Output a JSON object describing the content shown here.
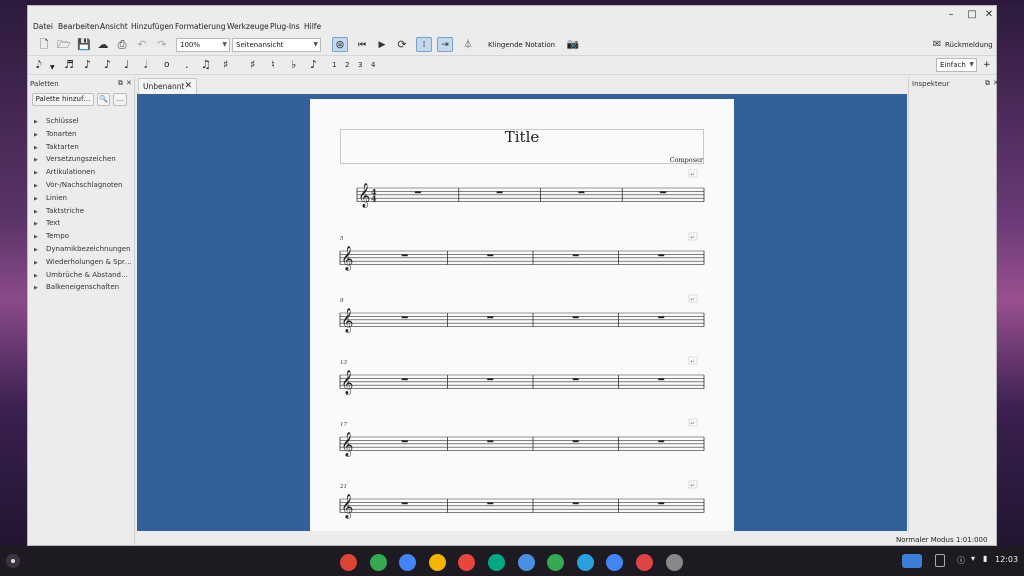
{
  "menu": [
    "Datei",
    "Bearbeiten",
    "Ansicht",
    "Hinzufügen",
    "Formatierung",
    "Werkzeuge",
    "Plug-Ins",
    "Hilfe"
  ],
  "toolbar": {
    "zoom": "100%",
    "view_mode": "Seitenansicht",
    "concert_pitch": "Klingende Notation",
    "feedback": "Rückmeldung"
  },
  "note_toolbar": {
    "voices": [
      "1",
      "2",
      "3",
      "4"
    ],
    "layout_mode": "Einfach",
    "add": "+"
  },
  "palettes": {
    "title": "Paletten",
    "add_button": "Palette hinzuf…",
    "items": [
      "Schlüssel",
      "Tonarten",
      "Taktarten",
      "Versetzungszeichen",
      "Artikulationen",
      "Vor-/Nachschlagnoten",
      "Linien",
      "Taktstriche",
      "Text",
      "Tempo",
      "Dynamikbezeichnungen",
      "Wiederholungen & Spr…",
      "Umbrüche & Abstand…",
      "Balkeneigenschaften"
    ]
  },
  "inspector": {
    "title": "Inspekteur"
  },
  "score_tab": {
    "label": "Unbenannt"
  },
  "score": {
    "title": "Title",
    "composer": "Composer",
    "time_signature": [
      "4",
      "4"
    ],
    "systems": [
      {
        "number": ""
      },
      {
        "number": "5"
      },
      {
        "number": "9"
      },
      {
        "number": "13"
      },
      {
        "number": "17"
      },
      {
        "number": "21"
      }
    ]
  },
  "status": {
    "mode": "Normaler Modus",
    "position": "1:01:000"
  },
  "shelf": {
    "time": "12:03",
    "apps": [
      "chrome",
      "drive",
      "app-3",
      "app-4",
      "app-5",
      "app-6",
      "files",
      "play-store",
      "telegram",
      "app-10",
      "app-11",
      "app-12"
    ]
  }
}
